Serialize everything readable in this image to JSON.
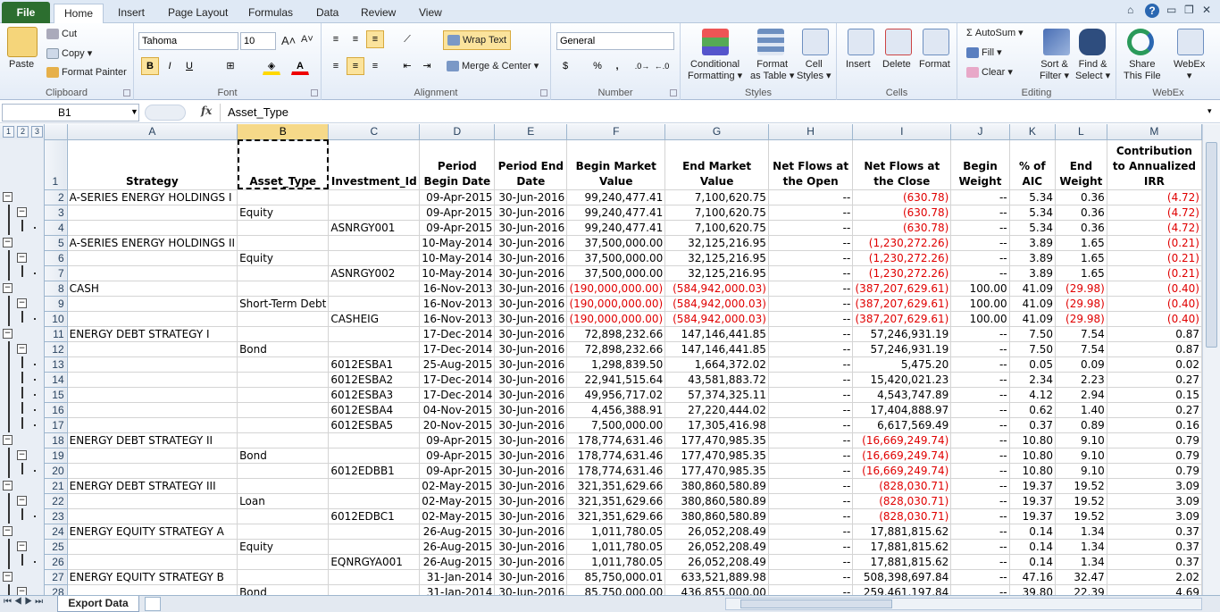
{
  "tabs": [
    "File",
    "Home",
    "Insert",
    "Page Layout",
    "Formulas",
    "Data",
    "Review",
    "View"
  ],
  "clipboard": {
    "paste": "Paste",
    "cut": "Cut",
    "copy": "Copy",
    "format_painter": "Format Painter",
    "label": "Clipboard"
  },
  "font": {
    "name": "Tahoma",
    "size": "10",
    "label": "Font",
    "bold": "B",
    "italic": "I",
    "underline": "U"
  },
  "alignment": {
    "wrap_text": "Wrap Text",
    "merge_center": "Merge & Center",
    "label": "Alignment"
  },
  "number": {
    "format": "General",
    "currency": "$",
    "percent": "%",
    "comma": ",",
    "label": "Number"
  },
  "styles": {
    "conditional": "Conditional",
    "formatting": "Formatting",
    "format_as": "Format",
    "as_table": "as Table",
    "cell": "Cell",
    "cell_styles": "Styles",
    "label": "Styles"
  },
  "cells": {
    "insert": "Insert",
    "delete": "Delete",
    "format": "Format",
    "label": "Cells"
  },
  "editing": {
    "autosum": "AutoSum",
    "fill": "Fill",
    "clear": "Clear",
    "sort": "Sort &",
    "filter": "Filter",
    "find": "Find &",
    "select": "Select",
    "label": "Editing"
  },
  "webex": {
    "share": "Share",
    "this_file": "This File",
    "webex": "WebEx",
    "label": "WebEx"
  },
  "formula_bar": {
    "name_box": "B1",
    "fx": "fx",
    "content": "Asset_Type"
  },
  "outline_levels": [
    "1",
    "2",
    "3"
  ],
  "columns": [
    "A",
    "B",
    "C",
    "D",
    "E",
    "F",
    "G",
    "H",
    "I",
    "J",
    "K",
    "L",
    "M"
  ],
  "headers": [
    "Strategy",
    "Asset_Type",
    "Investment_Id",
    "Period Begin Date",
    "Period End Date",
    "Begin Market Value",
    "End Market Value",
    "Net Flows at the Open",
    "Net Flows at the Close",
    "Begin Weight",
    "% of AIC",
    "End Weight",
    "Contribution to Annualized IRR"
  ],
  "rows": [
    {
      "n": "2",
      "o": "1",
      "c": [
        "A-SERIES ENERGY HOLDINGS I",
        "",
        "",
        "09-Apr-2015",
        "30-Jun-2016",
        "99,240,477.41",
        "7,100,620.75",
        "--",
        "(630.78)",
        "--",
        "5.34",
        "0.36",
        "(4.72)"
      ]
    },
    {
      "n": "3",
      "o": "2",
      "c": [
        "",
        "Equity",
        "",
        "09-Apr-2015",
        "30-Jun-2016",
        "99,240,477.41",
        "7,100,620.75",
        "--",
        "(630.78)",
        "--",
        "5.34",
        "0.36",
        "(4.72)"
      ]
    },
    {
      "n": "4",
      "o": "3",
      "c": [
        "",
        "",
        "ASNRGY001",
        "09-Apr-2015",
        "30-Jun-2016",
        "99,240,477.41",
        "7,100,620.75",
        "--",
        "(630.78)",
        "--",
        "5.34",
        "0.36",
        "(4.72)"
      ]
    },
    {
      "n": "5",
      "o": "1",
      "c": [
        "A-SERIES ENERGY HOLDINGS II",
        "",
        "",
        "10-May-2014",
        "30-Jun-2016",
        "37,500,000.00",
        "32,125,216.95",
        "--",
        "(1,230,272.26)",
        "--",
        "3.89",
        "1.65",
        "(0.21)"
      ]
    },
    {
      "n": "6",
      "o": "2",
      "c": [
        "",
        "Equity",
        "",
        "10-May-2014",
        "30-Jun-2016",
        "37,500,000.00",
        "32,125,216.95",
        "--",
        "(1,230,272.26)",
        "--",
        "3.89",
        "1.65",
        "(0.21)"
      ]
    },
    {
      "n": "7",
      "o": "3",
      "c": [
        "",
        "",
        "ASNRGY002",
        "10-May-2014",
        "30-Jun-2016",
        "37,500,000.00",
        "32,125,216.95",
        "--",
        "(1,230,272.26)",
        "--",
        "3.89",
        "1.65",
        "(0.21)"
      ]
    },
    {
      "n": "8",
      "o": "1",
      "c": [
        "CASH",
        "",
        "",
        "16-Nov-2013",
        "30-Jun-2016",
        "(190,000,000.00)",
        "(584,942,000.03)",
        "--",
        "(387,207,629.61)",
        "100.00",
        "41.09",
        "(29.98)",
        "(0.40)"
      ]
    },
    {
      "n": "9",
      "o": "2",
      "c": [
        "",
        "Short-Term Debt",
        "",
        "16-Nov-2013",
        "30-Jun-2016",
        "(190,000,000.00)",
        "(584,942,000.03)",
        "--",
        "(387,207,629.61)",
        "100.00",
        "41.09",
        "(29.98)",
        "(0.40)"
      ]
    },
    {
      "n": "10",
      "o": "3",
      "c": [
        "",
        "",
        "CASHEIG",
        "16-Nov-2013",
        "30-Jun-2016",
        "(190,000,000.00)",
        "(584,942,000.03)",
        "--",
        "(387,207,629.61)",
        "100.00",
        "41.09",
        "(29.98)",
        "(0.40)"
      ]
    },
    {
      "n": "11",
      "o": "1",
      "c": [
        "ENERGY DEBT STRATEGY I",
        "",
        "",
        "17-Dec-2014",
        "30-Jun-2016",
        "72,898,232.66",
        "147,146,441.85",
        "--",
        "57,246,931.19",
        "--",
        "7.50",
        "7.54",
        "0.87"
      ]
    },
    {
      "n": "12",
      "o": "2",
      "c": [
        "",
        "Bond",
        "",
        "17-Dec-2014",
        "30-Jun-2016",
        "72,898,232.66",
        "147,146,441.85",
        "--",
        "57,246,931.19",
        "--",
        "7.50",
        "7.54",
        "0.87"
      ]
    },
    {
      "n": "13",
      "o": "3",
      "c": [
        "",
        "",
        "6012ESBA1",
        "25-Aug-2015",
        "30-Jun-2016",
        "1,298,839.50",
        "1,664,372.02",
        "--",
        "5,475.20",
        "--",
        "0.05",
        "0.09",
        "0.02"
      ]
    },
    {
      "n": "14",
      "o": "3",
      "c": [
        "",
        "",
        "6012ESBA2",
        "17-Dec-2014",
        "30-Jun-2016",
        "22,941,515.64",
        "43,581,883.72",
        "--",
        "15,420,021.23",
        "--",
        "2.34",
        "2.23",
        "0.27"
      ]
    },
    {
      "n": "15",
      "o": "3",
      "c": [
        "",
        "",
        "6012ESBA3",
        "17-Dec-2014",
        "30-Jun-2016",
        "49,956,717.02",
        "57,374,325.11",
        "--",
        "4,543,747.89",
        "--",
        "4.12",
        "2.94",
        "0.15"
      ]
    },
    {
      "n": "16",
      "o": "3",
      "c": [
        "",
        "",
        "6012ESBA4",
        "04-Nov-2015",
        "30-Jun-2016",
        "4,456,388.91",
        "27,220,444.02",
        "--",
        "17,404,888.97",
        "--",
        "0.62",
        "1.40",
        "0.27"
      ]
    },
    {
      "n": "17",
      "o": "3",
      "c": [
        "",
        "",
        "6012ESBA5",
        "20-Nov-2015",
        "30-Jun-2016",
        "7,500,000.00",
        "17,305,416.98",
        "--",
        "6,617,569.49",
        "--",
        "0.37",
        "0.89",
        "0.16"
      ]
    },
    {
      "n": "18",
      "o": "1",
      "c": [
        "ENERGY DEBT STRATEGY II",
        "",
        "",
        "09-Apr-2015",
        "30-Jun-2016",
        "178,774,631.46",
        "177,470,985.35",
        "--",
        "(16,669,249.74)",
        "--",
        "10.80",
        "9.10",
        "0.79"
      ]
    },
    {
      "n": "19",
      "o": "2",
      "c": [
        "",
        "Bond",
        "",
        "09-Apr-2015",
        "30-Jun-2016",
        "178,774,631.46",
        "177,470,985.35",
        "--",
        "(16,669,249.74)",
        "--",
        "10.80",
        "9.10",
        "0.79"
      ]
    },
    {
      "n": "20",
      "o": "3",
      "c": [
        "",
        "",
        "6012EDBB1",
        "09-Apr-2015",
        "30-Jun-2016",
        "178,774,631.46",
        "177,470,985.35",
        "--",
        "(16,669,249.74)",
        "--",
        "10.80",
        "9.10",
        "0.79"
      ]
    },
    {
      "n": "21",
      "o": "1",
      "c": [
        "ENERGY DEBT STRATEGY III",
        "",
        "",
        "02-May-2015",
        "30-Jun-2016",
        "321,351,629.66",
        "380,860,580.89",
        "--",
        "(828,030.71)",
        "--",
        "19.37",
        "19.52",
        "3.09"
      ]
    },
    {
      "n": "22",
      "o": "2",
      "c": [
        "",
        "Loan",
        "",
        "02-May-2015",
        "30-Jun-2016",
        "321,351,629.66",
        "380,860,580.89",
        "--",
        "(828,030.71)",
        "--",
        "19.37",
        "19.52",
        "3.09"
      ]
    },
    {
      "n": "23",
      "o": "3",
      "c": [
        "",
        "",
        "6012EDBC1",
        "02-May-2015",
        "30-Jun-2016",
        "321,351,629.66",
        "380,860,580.89",
        "--",
        "(828,030.71)",
        "--",
        "19.37",
        "19.52",
        "3.09"
      ]
    },
    {
      "n": "24",
      "o": "1",
      "c": [
        "ENERGY EQUITY STRATEGY A",
        "",
        "",
        "26-Aug-2015",
        "30-Jun-2016",
        "1,011,780.05",
        "26,052,208.49",
        "--",
        "17,881,815.62",
        "--",
        "0.14",
        "1.34",
        "0.37"
      ]
    },
    {
      "n": "25",
      "o": "2",
      "c": [
        "",
        "Equity",
        "",
        "26-Aug-2015",
        "30-Jun-2016",
        "1,011,780.05",
        "26,052,208.49",
        "--",
        "17,881,815.62",
        "--",
        "0.14",
        "1.34",
        "0.37"
      ]
    },
    {
      "n": "26",
      "o": "3",
      "c": [
        "",
        "",
        "EQNRGYA001",
        "26-Aug-2015",
        "30-Jun-2016",
        "1,011,780.05",
        "26,052,208.49",
        "--",
        "17,881,815.62",
        "--",
        "0.14",
        "1.34",
        "0.37"
      ]
    },
    {
      "n": "27",
      "o": "1",
      "c": [
        "ENERGY EQUITY STRATEGY B",
        "",
        "",
        "31-Jan-2014",
        "30-Jun-2016",
        "85,750,000.01",
        "633,521,889.98",
        "--",
        "508,398,697.84",
        "--",
        "47.16",
        "32.47",
        "2.02"
      ]
    },
    {
      "n": "28",
      "o": "2",
      "c": [
        "",
        "Bond",
        "",
        "31-Jan-2014",
        "30-Jun-2016",
        "85,750,000.00",
        "436,855,000.00",
        "--",
        "259,461,197.84",
        "--",
        "39.80",
        "22.39",
        "4.69"
      ]
    }
  ],
  "sheet_tab": "Export Data"
}
